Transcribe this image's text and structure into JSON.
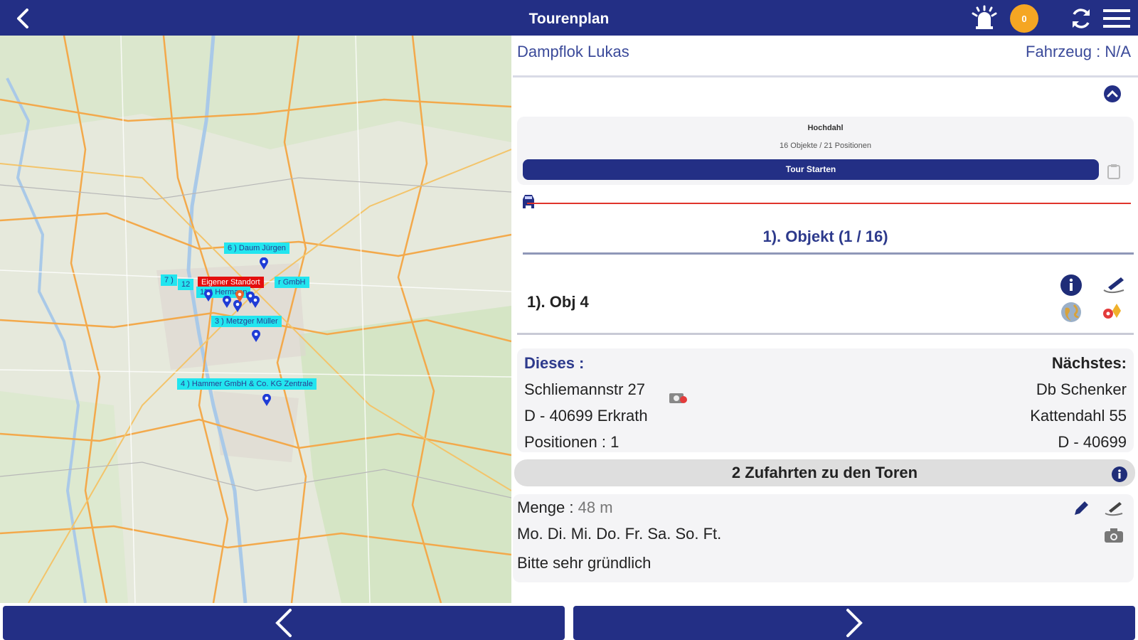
{
  "header": {
    "title": "Tourenplan",
    "badge_count": "0"
  },
  "colors": {
    "primary": "#232f85",
    "accent_orange": "#f5a623",
    "label_cyan": "#22e5ef",
    "label_red": "#e40d0d"
  },
  "icons": {
    "back": "chevron-left-icon",
    "alarm": "alarm-icon",
    "refresh": "refresh-icon",
    "menu": "hamburger-menu-icon"
  },
  "map": {
    "labels": [
      "6 ) Daum Jürgen",
      "7 )",
      "12",
      "Eigener Standort",
      "r GmbH",
      "11 ) Hermann",
      "3 ) Metzger Müller",
      "4 ) Hammer GmbH & Co. KG Zentrale"
    ]
  },
  "panel": {
    "driver": "Dampflok Lukas",
    "vehicle": "Fahrzeug : N/A",
    "tour": {
      "name": "Hochdahl",
      "count": "16 Objekte / 21 Positionen",
      "start_label": "Tour Starten"
    },
    "objekt_heading": "1). Objekt  (1 / 16)",
    "object_name": "1). Obj 4",
    "current": {
      "label": "Dieses :",
      "street": "Schliemannstr 27",
      "city": "D - 40699 Erkrath",
      "positions": "Positionen : 1"
    },
    "next": {
      "label": "Nächstes:",
      "name": "Db Schenker",
      "street": "Kattendahl 55",
      "city": "D - 40699"
    },
    "zufahrten": "2 Zufahrten zu den Toren",
    "menge_label": "Menge : ",
    "menge_value": "48 m",
    "days": "Mo. Di. Mi. Do. Fr. Sa. So. Ft.",
    "note": "Bitte sehr gründlich"
  }
}
